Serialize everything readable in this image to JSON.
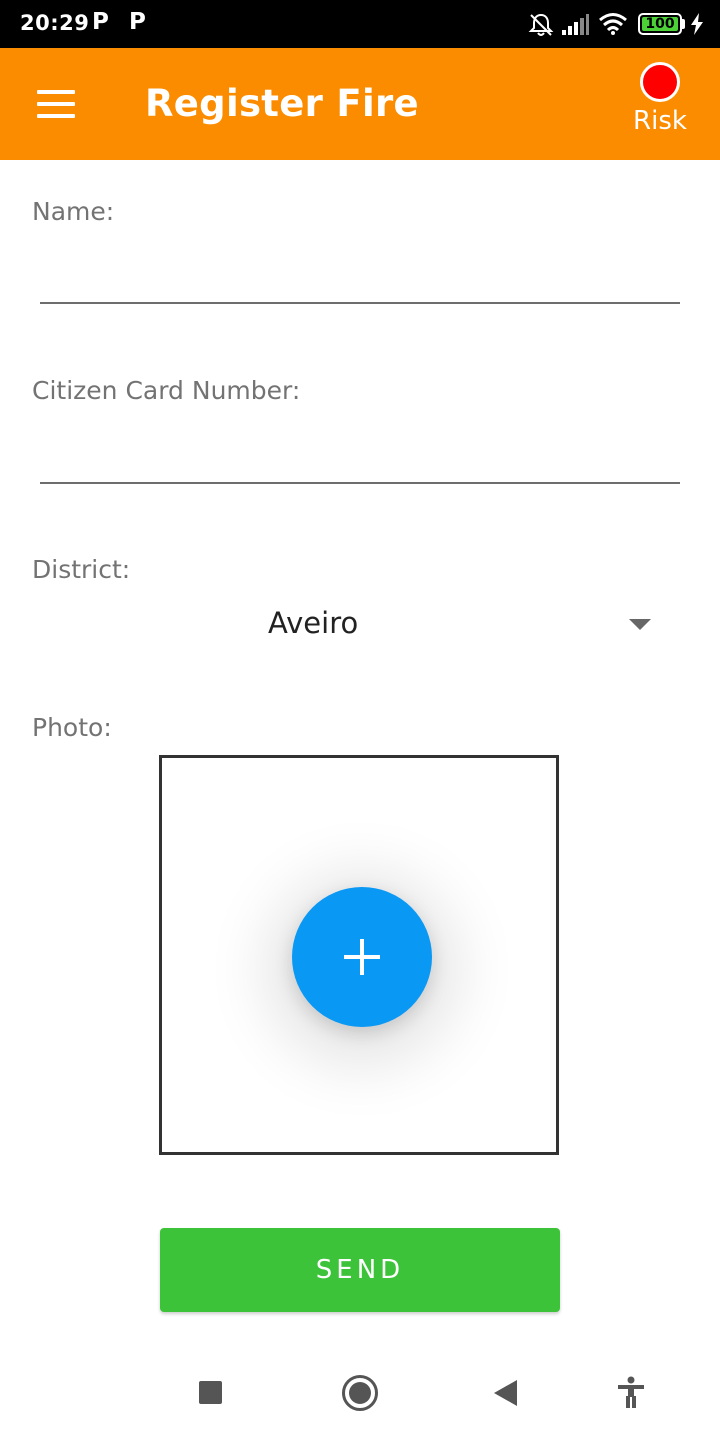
{
  "status_bar": {
    "time": "20:29",
    "notification_icons": [
      "P",
      "P"
    ],
    "battery_level": "100",
    "battery_fraction": 1.0
  },
  "app_bar": {
    "title": "Register Fire",
    "risk_label": "Risk",
    "risk_color": "#ff0000",
    "background_color": "#fb8c00"
  },
  "form": {
    "name_label": "Name:",
    "name_value": "",
    "citizen_card_label": "Citizen Card Number:",
    "citizen_card_value": "",
    "district_label": "District:",
    "district_selected": "Aveiro",
    "photo_label": "Photo:",
    "add_photo_color": "#0a98f5"
  },
  "send_button": {
    "label": "SEND",
    "color": "#3dc33a"
  },
  "nav_bar": {
    "icons": [
      "recents-square-icon",
      "home-circle-icon",
      "back-triangle-icon",
      "accessibility-icon"
    ]
  }
}
